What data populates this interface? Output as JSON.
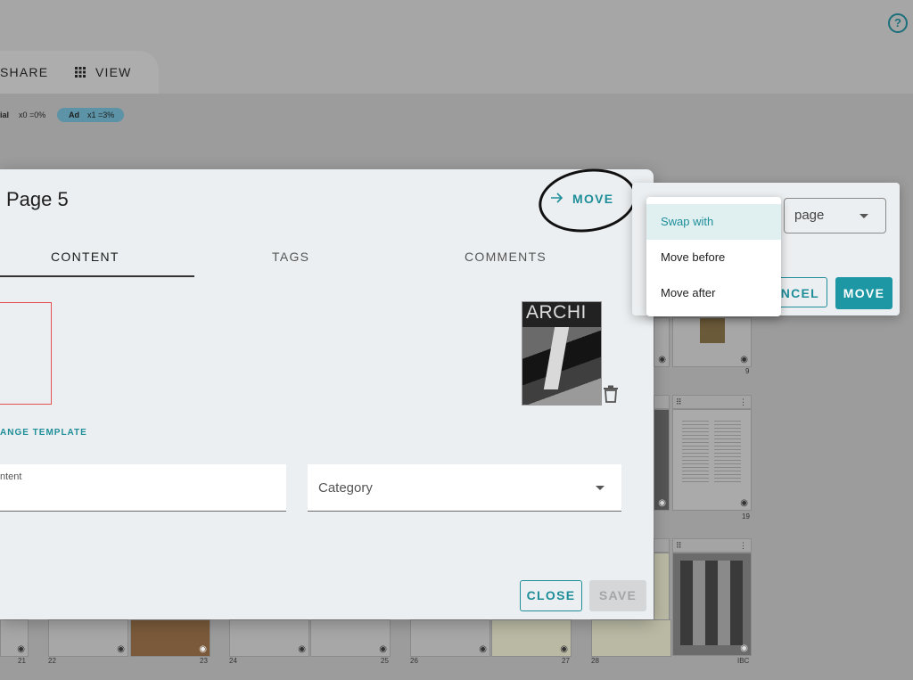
{
  "toolbar": {
    "share_label": "SHARE",
    "view_label": "VIEW"
  },
  "stats": {
    "editorial_fragment": "ial",
    "editorial_count": "x0 =0%",
    "ad_label": "Ad",
    "ad_count": "x1 =3%"
  },
  "page_numbers": {
    "p9": "9",
    "p19": "19",
    "p21": "21",
    "p22": "22",
    "p23": "23",
    "p24": "24",
    "p25": "25",
    "p26": "26",
    "p27": "27",
    "p28": "28",
    "ibc": "IBC"
  },
  "dialog": {
    "title": "Page 5",
    "move_label": "MOVE",
    "tabs": [
      "CONTENT",
      "TAGS",
      "COMMENTS"
    ],
    "change_template_label": "ANGE TEMPLATE",
    "cover_text": "ARCHI",
    "content_label": "ntent",
    "category_label": "Category",
    "close_label": "CLOSE",
    "save_label": "SAVE"
  },
  "move_panel": {
    "page_select_value": "page",
    "cancel_label": "NCEL",
    "move_label": "MOVE",
    "options": [
      "Swap with",
      "Move before",
      "Move after"
    ],
    "selected_option": "Swap with"
  },
  "colors": {
    "accent": "#1e8e99",
    "accent_fill": "#1e97a4",
    "dialog_bg": "#eceff1",
    "overlay_bg": "#9c9c9c"
  }
}
